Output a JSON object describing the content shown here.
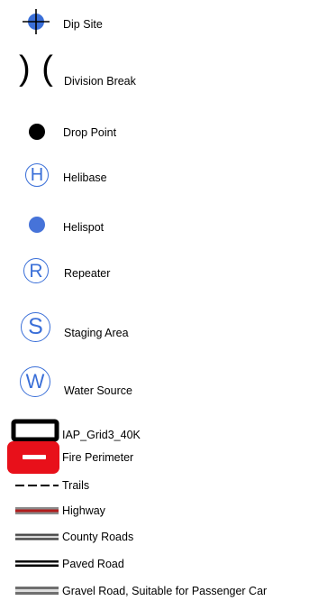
{
  "legend": {
    "items": [
      {
        "label": "Dip Site",
        "icon": "dip-site-crosshair-icon"
      },
      {
        "label": "Division Break",
        "glyph": ") ("
      },
      {
        "label": "Drop Point",
        "icon": "black-dot-icon"
      },
      {
        "label": "Helibase",
        "glyph": "H"
      },
      {
        "label": "Helispot",
        "icon": "blue-dot-icon"
      },
      {
        "label": "Repeater",
        "glyph": "R"
      },
      {
        "label": "Staging Area",
        "glyph": "S"
      },
      {
        "label": "Water Source",
        "glyph": "W"
      },
      {
        "label": "IAP_Grid3_40K",
        "icon": "black-outline-rectangle-icon"
      },
      {
        "label": "Fire Perimeter",
        "icon": "red-rounded-box-icon"
      },
      {
        "label": "Trails",
        "icon": "dashed-line-icon"
      },
      {
        "label": "Highway",
        "icon": "red-double-line-icon"
      },
      {
        "label": "County Roads",
        "icon": "gray-double-line-icon"
      },
      {
        "label": "Paved Road",
        "icon": "black-double-line-icon"
      },
      {
        "label": "Gravel Road, Suitable for Passenger Car",
        "icon": "cased-gray-line-icon"
      }
    ]
  },
  "colors": {
    "symbol_blue": "#3a6fd8",
    "highway_red": "#b11d1d",
    "fire_red": "#e8101a",
    "road_gray": "#8a8a8a"
  }
}
